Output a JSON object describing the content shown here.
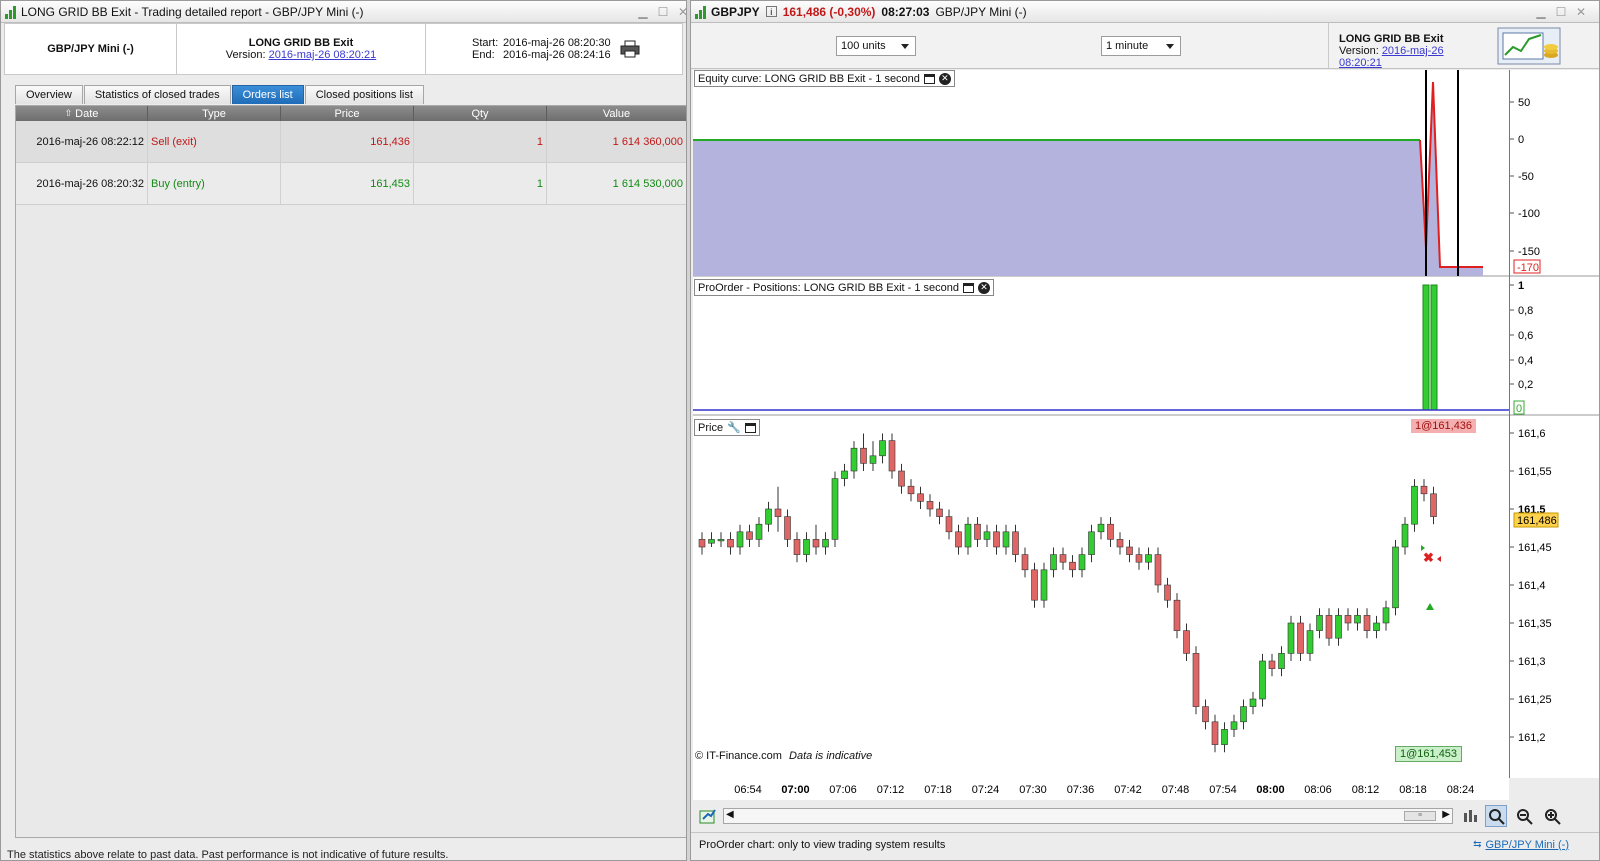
{
  "left": {
    "title": "LONG GRID BB Exit - Trading detailed report - GBP/JPY Mini (-)",
    "instrument": "GBP/JPY Mini (-)",
    "system_name": "LONG GRID BB Exit",
    "version_label": "Version:",
    "version_value": "2016-maj-26 08:20:21",
    "start_label": "Start:",
    "start_value": "2016-maj-26 08:20:30",
    "end_label": "End:",
    "end_value": "2016-maj-26 08:24:16",
    "tabs": [
      "Overview",
      "Statistics of closed trades",
      "Orders list",
      "Closed positions list"
    ],
    "active_tab": "Orders list",
    "columns": [
      "Date",
      "Type",
      "Price",
      "Qty",
      "Value"
    ],
    "rows": [
      {
        "date": "2016-maj-26 08:22:12",
        "type": "Sell (exit)",
        "price": "161,436",
        "qty": "1",
        "value": "1 614 360,000",
        "color": "red"
      },
      {
        "date": "2016-maj-26 08:20:32",
        "type": "Buy (entry)",
        "price": "161,453",
        "qty": "1",
        "value": "1 614 530,000",
        "color": "green"
      }
    ],
    "footer": "The statistics above relate to past data. Past performance is not indicative of future results."
  },
  "right": {
    "symbol": "GBPJPY",
    "price_change": "161,486 (-0,30%)",
    "time": "08:27:03",
    "instrument_title": "GBP/JPY Mini (-)",
    "units_select": "100 units",
    "timeframe_select": "1 minute",
    "system_name": "LONG GRID BB Exit",
    "version_label": "Version:",
    "version_value": "2016-maj-26 08:20:21",
    "equity_label": "Equity curve: LONG GRID BB Exit - 1 second",
    "positions_label": "ProOrder - Positions: LONG GRID BB Exit - 1 second",
    "price_label": "Price",
    "copyright": "© IT-Finance.com",
    "indicative": "Data is indicative",
    "order_exit_tag": "1@161,436",
    "order_entry_tag": "1@161,453",
    "last_price_tag": "161,486",
    "equity_last_tag": "-170",
    "positions_last_tag": "0",
    "equity_ticks": [
      "50",
      "0",
      "-50",
      "-100",
      "-150"
    ],
    "positions_ticks": [
      "1",
      "0,8",
      "0,6",
      "0,4",
      "0,2"
    ],
    "price_ticks": [
      "161,6",
      "161,55",
      "161,5",
      "161,45",
      "161,4",
      "161,35",
      "161,3",
      "161,25",
      "161,2"
    ],
    "time_ticks": [
      "06:54",
      "07:00",
      "07:06",
      "07:12",
      "07:18",
      "07:24",
      "07:30",
      "07:36",
      "07:42",
      "07:48",
      "07:54",
      "08:00",
      "08:06",
      "08:12",
      "08:18",
      "08:24"
    ],
    "status": "ProOrder chart: only to view trading system results",
    "status_link": "GBP/JPY Mini (-)",
    "colors": {
      "up": "#33cc33",
      "down": "#e06666",
      "equity_fill": "#b3b3dd",
      "equity_line": "#22aa22"
    }
  }
}
